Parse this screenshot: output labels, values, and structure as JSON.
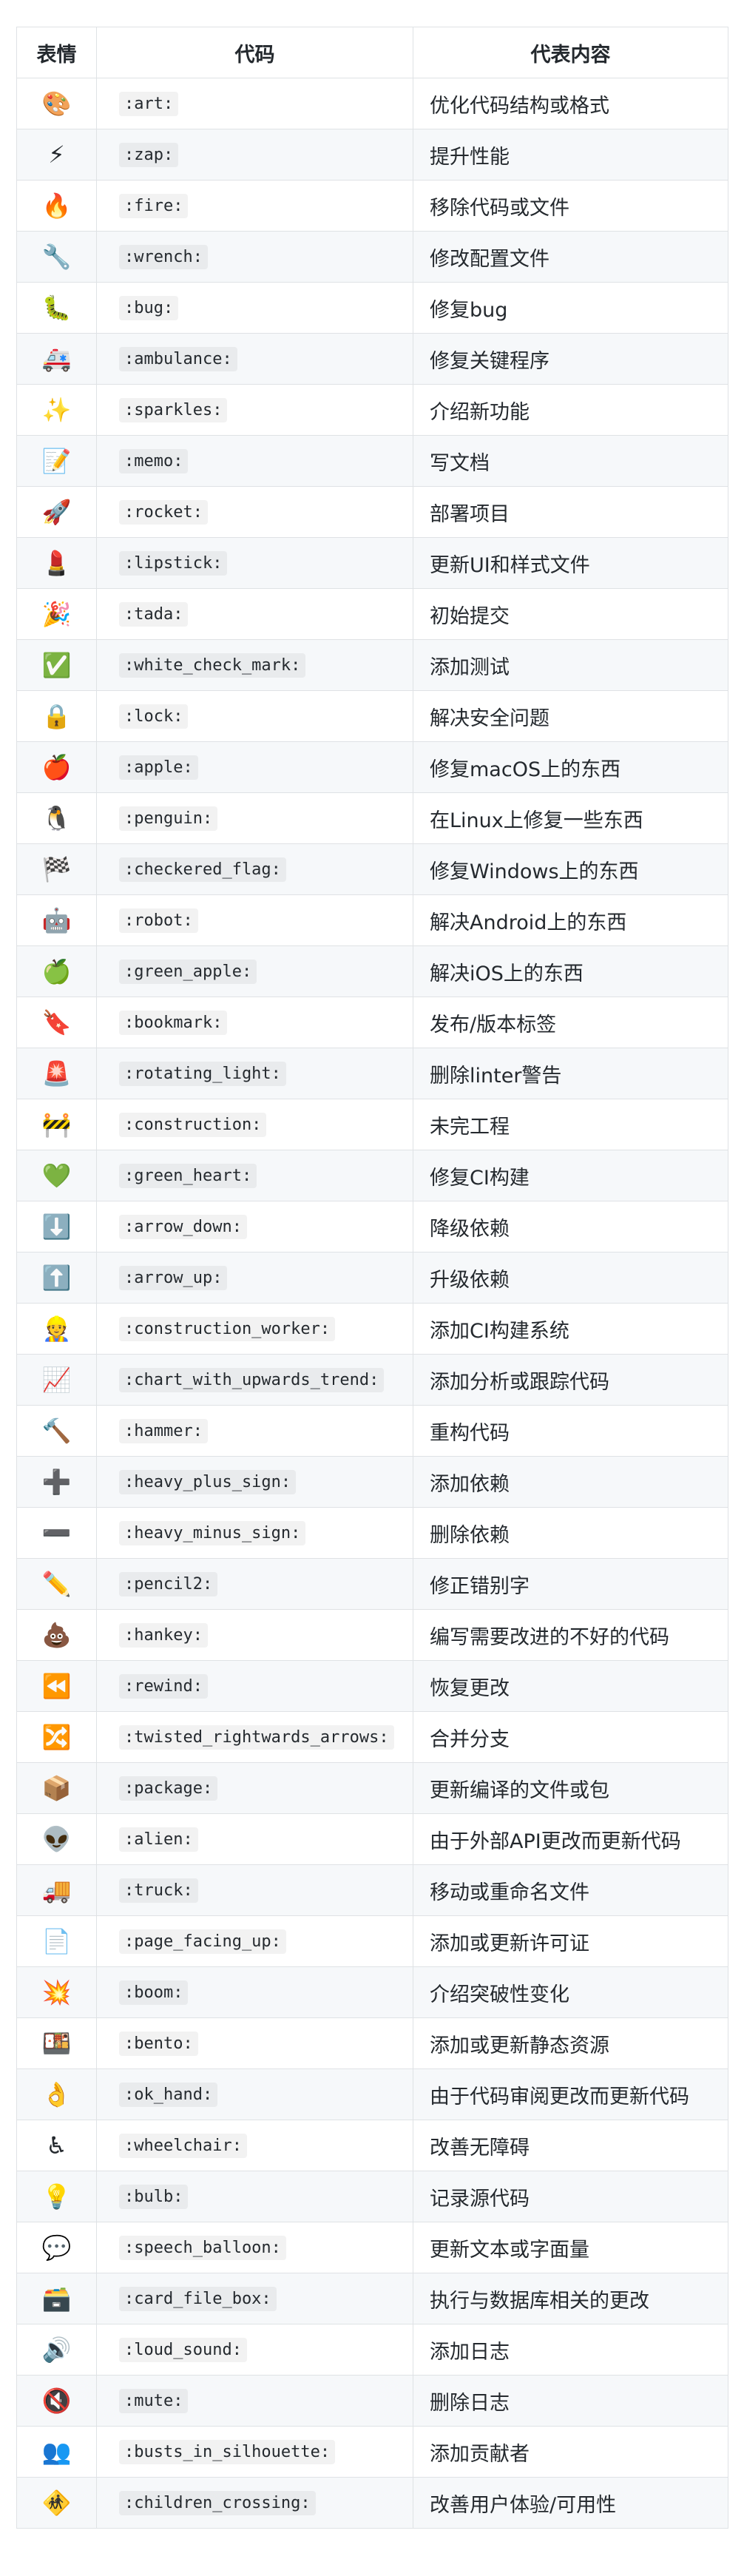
{
  "table": {
    "headers": {
      "emoji": "表情",
      "code": "代码",
      "desc": "代表内容"
    },
    "rows": [
      {
        "emoji": "🎨",
        "icon": "art-palette-icon",
        "code": ":art:",
        "desc": "优化代码结构或格式"
      },
      {
        "emoji": "⚡",
        "icon": "zap-icon",
        "code": ":zap:",
        "desc": "提升性能"
      },
      {
        "emoji": "🔥",
        "icon": "fire-icon",
        "code": ":fire:",
        "desc": "移除代码或文件"
      },
      {
        "emoji": "🔧",
        "icon": "wrench-icon",
        "code": ":wrench:",
        "desc": "修改配置文件"
      },
      {
        "emoji": "🐛",
        "icon": "bug-icon",
        "code": ":bug:",
        "desc": "修复bug"
      },
      {
        "emoji": "🚑",
        "icon": "ambulance-icon",
        "code": ":ambulance:",
        "desc": "修复关键程序"
      },
      {
        "emoji": "✨",
        "icon": "sparkles-icon",
        "code": ":sparkles:",
        "desc": "介绍新功能"
      },
      {
        "emoji": "📝",
        "icon": "memo-icon",
        "code": ":memo:",
        "desc": "写文档"
      },
      {
        "emoji": "🚀",
        "icon": "rocket-icon",
        "code": ":rocket:",
        "desc": "部署项目"
      },
      {
        "emoji": "💄",
        "icon": "lipstick-icon",
        "code": ":lipstick:",
        "desc": "更新UI和样式文件"
      },
      {
        "emoji": "🎉",
        "icon": "tada-icon",
        "code": ":tada:",
        "desc": "初始提交"
      },
      {
        "emoji": "✅",
        "icon": "white-check-mark-icon",
        "code": ":white_check_mark:",
        "desc": "添加测试"
      },
      {
        "emoji": "🔒",
        "icon": "lock-icon",
        "code": ":lock:",
        "desc": "解决安全问题"
      },
      {
        "emoji": "🍎",
        "icon": "apple-icon",
        "code": ":apple:",
        "desc": "修复macOS上的东西"
      },
      {
        "emoji": "🐧",
        "icon": "penguin-icon",
        "code": ":penguin:",
        "desc": "在Linux上修复一些东西"
      },
      {
        "emoji": "🏁",
        "icon": "checkered-flag-icon",
        "code": ":checkered_flag:",
        "desc": "修复Windows上的东西"
      },
      {
        "emoji": "🤖",
        "icon": "robot-icon",
        "code": ":robot:",
        "desc": "解决Android上的东西"
      },
      {
        "emoji": "🍏",
        "icon": "green-apple-icon",
        "code": ":green_apple:",
        "desc": "解决iOS上的东西"
      },
      {
        "emoji": "🔖",
        "icon": "bookmark-icon",
        "code": ":bookmark:",
        "desc": "发布/版本标签"
      },
      {
        "emoji": "🚨",
        "icon": "rotating-light-icon",
        "code": ":rotating_light:",
        "desc": "删除linter警告"
      },
      {
        "emoji": "🚧",
        "icon": "construction-icon",
        "code": ":construction:",
        "desc": "未完工程"
      },
      {
        "emoji": "💚",
        "icon": "green-heart-icon",
        "code": ":green_heart:",
        "desc": "修复CI构建"
      },
      {
        "emoji": "⬇️",
        "icon": "arrow-down-icon",
        "code": ":arrow_down:",
        "desc": "降级依赖"
      },
      {
        "emoji": "⬆️",
        "icon": "arrow-up-icon",
        "code": ":arrow_up:",
        "desc": "升级依赖"
      },
      {
        "emoji": "👷",
        "icon": "construction-worker-icon",
        "code": ":construction_worker:",
        "desc": "添加CI构建系统"
      },
      {
        "emoji": "📈",
        "icon": "chart-upwards-trend-icon",
        "code": ":chart_with_upwards_trend:",
        "desc": "添加分析或跟踪代码"
      },
      {
        "emoji": "🔨",
        "icon": "hammer-icon",
        "code": ":hammer:",
        "desc": "重构代码"
      },
      {
        "emoji": "➕",
        "icon": "heavy-plus-sign-icon",
        "code": ":heavy_plus_sign:",
        "desc": "添加依赖"
      },
      {
        "emoji": "➖",
        "icon": "heavy-minus-sign-icon",
        "code": ":heavy_minus_sign:",
        "desc": "删除依赖"
      },
      {
        "emoji": "✏️",
        "icon": "pencil-icon",
        "code": ":pencil2:",
        "desc": "修正错别字"
      },
      {
        "emoji": "💩",
        "icon": "hankey-icon",
        "code": ":hankey:",
        "desc": "编写需要改进的不好的代码"
      },
      {
        "emoji": "⏪",
        "icon": "rewind-icon",
        "code": ":rewind:",
        "desc": "恢复更改"
      },
      {
        "emoji": "🔀",
        "icon": "twisted-arrows-icon",
        "code": ":twisted_rightwards_arrows:",
        "desc": "合并分支"
      },
      {
        "emoji": "📦",
        "icon": "package-icon",
        "code": ":package:",
        "desc": "更新编译的文件或包"
      },
      {
        "emoji": "👽",
        "icon": "alien-icon",
        "code": ":alien:",
        "desc": "由于外部API更改而更新代码"
      },
      {
        "emoji": "🚚",
        "icon": "truck-icon",
        "code": ":truck:",
        "desc": "移动或重命名文件"
      },
      {
        "emoji": "📄",
        "icon": "page-facing-up-icon",
        "code": ":page_facing_up:",
        "desc": "添加或更新许可证"
      },
      {
        "emoji": "💥",
        "icon": "boom-icon",
        "code": ":boom:",
        "desc": "介绍突破性变化"
      },
      {
        "emoji": "🍱",
        "icon": "bento-icon",
        "code": ":bento:",
        "desc": "添加或更新静态资源"
      },
      {
        "emoji": "👌",
        "icon": "ok-hand-icon",
        "code": ":ok_hand:",
        "desc": "由于代码审阅更改而更新代码"
      },
      {
        "emoji": "♿",
        "icon": "wheelchair-icon",
        "code": ":wheelchair:",
        "desc": "改善无障碍"
      },
      {
        "emoji": "💡",
        "icon": "bulb-icon",
        "code": ":bulb:",
        "desc": "记录源代码"
      },
      {
        "emoji": "💬",
        "icon": "speech-balloon-icon",
        "code": ":speech_balloon:",
        "desc": "更新文本或字面量"
      },
      {
        "emoji": "🗃️",
        "icon": "card-file-box-icon",
        "code": ":card_file_box:",
        "desc": "执行与数据库相关的更改"
      },
      {
        "emoji": "🔊",
        "icon": "loud-sound-icon",
        "code": ":loud_sound:",
        "desc": "添加日志"
      },
      {
        "emoji": "🔇",
        "icon": "mute-icon",
        "code": ":mute:",
        "desc": "删除日志"
      },
      {
        "emoji": "👥",
        "icon": "busts-in-silhouette-icon",
        "code": ":busts_in_silhouette:",
        "desc": "添加贡献者"
      },
      {
        "emoji": "🚸",
        "icon": "children-crossing-icon",
        "code": ":children_crossing:",
        "desc": "改善用户体验/可用性"
      }
    ]
  }
}
